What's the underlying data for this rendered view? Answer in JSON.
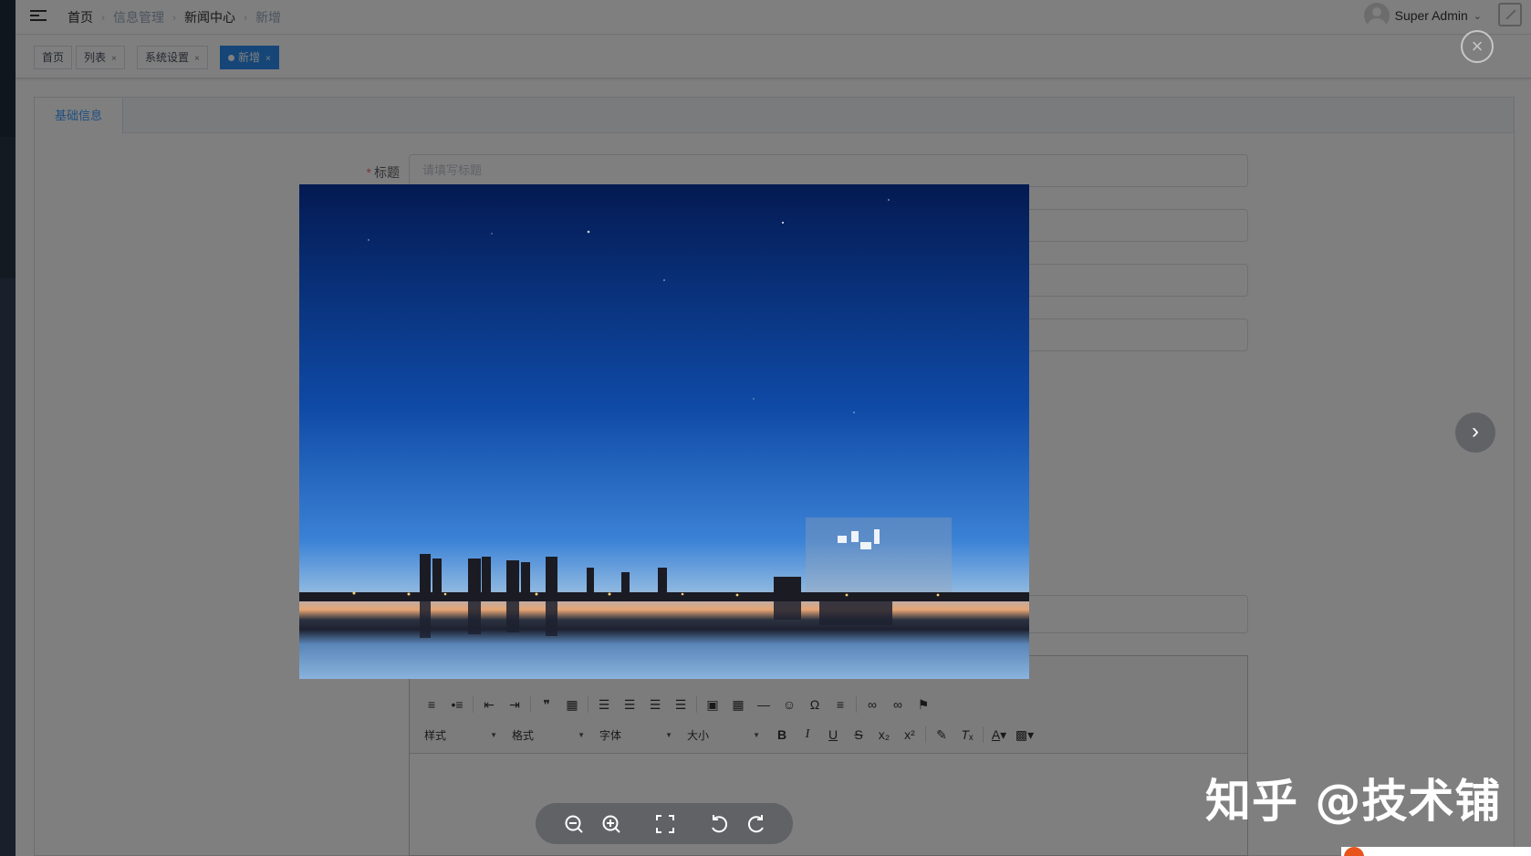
{
  "navbar": {
    "breadcrumb": [
      "首页",
      "信息管理",
      "新闻中心",
      "新增"
    ],
    "user_name": "Super Admin"
  },
  "tags": [
    {
      "label": "首页"
    },
    {
      "label": "列表"
    },
    {
      "label": "系统设置"
    },
    {
      "label": "新增",
      "active": true
    }
  ],
  "card": {
    "tab_label": "基础信息"
  },
  "form": {
    "title_label": "标题",
    "title_placeholder": "请填写标题"
  },
  "editor": {
    "combos": [
      "样式",
      "格式",
      "字体",
      "大小"
    ],
    "format_buttons": [
      "B",
      "I",
      "U",
      "S"
    ]
  },
  "viewer": {
    "close_symbol": "×",
    "next_symbol": "›"
  },
  "watermark": "知乎 @技术铺",
  "colors": {
    "sidebar": "#304156",
    "active_tag": "#2d8cf0",
    "link_blue": "#409eff",
    "required": "#f56c6c"
  }
}
